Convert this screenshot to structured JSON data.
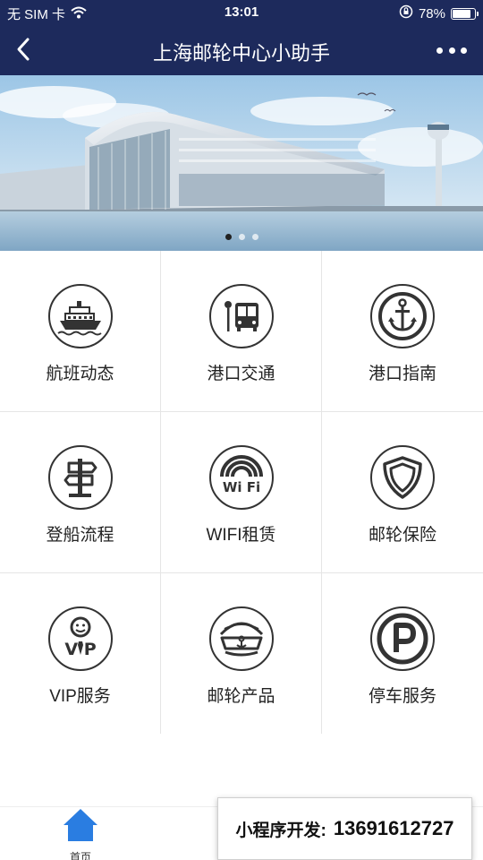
{
  "status_bar": {
    "carrier": "无 SIM 卡",
    "time": "13:01",
    "battery": "78%",
    "battery_level": 0.78,
    "wifi_icon": "wifi-icon",
    "lock_icon": "rotation-lock-icon"
  },
  "nav": {
    "title": "上海邮轮中心小助手",
    "back_icon": "back-chevron-icon",
    "more_icon": "more-dots-icon"
  },
  "banner": {
    "slide_count": 3,
    "active_slide": 0
  },
  "grid": {
    "items": [
      {
        "label": "航班动态",
        "icon": "cruise-ship-icon"
      },
      {
        "label": "港口交通",
        "icon": "bus-stop-icon"
      },
      {
        "label": "港口指南",
        "icon": "anchor-icon"
      },
      {
        "label": "登船流程",
        "icon": "signpost-icon"
      },
      {
        "label": "WIFI租赁",
        "icon": "wifi-rental-icon"
      },
      {
        "label": "邮轮保险",
        "icon": "shield-icon"
      },
      {
        "label": "VIP服务",
        "icon": "vip-icon"
      },
      {
        "label": "邮轮产品",
        "icon": "captain-hat-icon"
      },
      {
        "label": "停车服务",
        "icon": "parking-icon"
      }
    ]
  },
  "tabbar": {
    "home_label": "首页",
    "home_icon": "home-icon"
  },
  "promo": {
    "label": "小程序开发:",
    "phone": "13691612727"
  },
  "colors": {
    "nav_bg": "#1d2a5c",
    "icon_stroke": "#333333",
    "tab_active": "#2a7de1"
  }
}
